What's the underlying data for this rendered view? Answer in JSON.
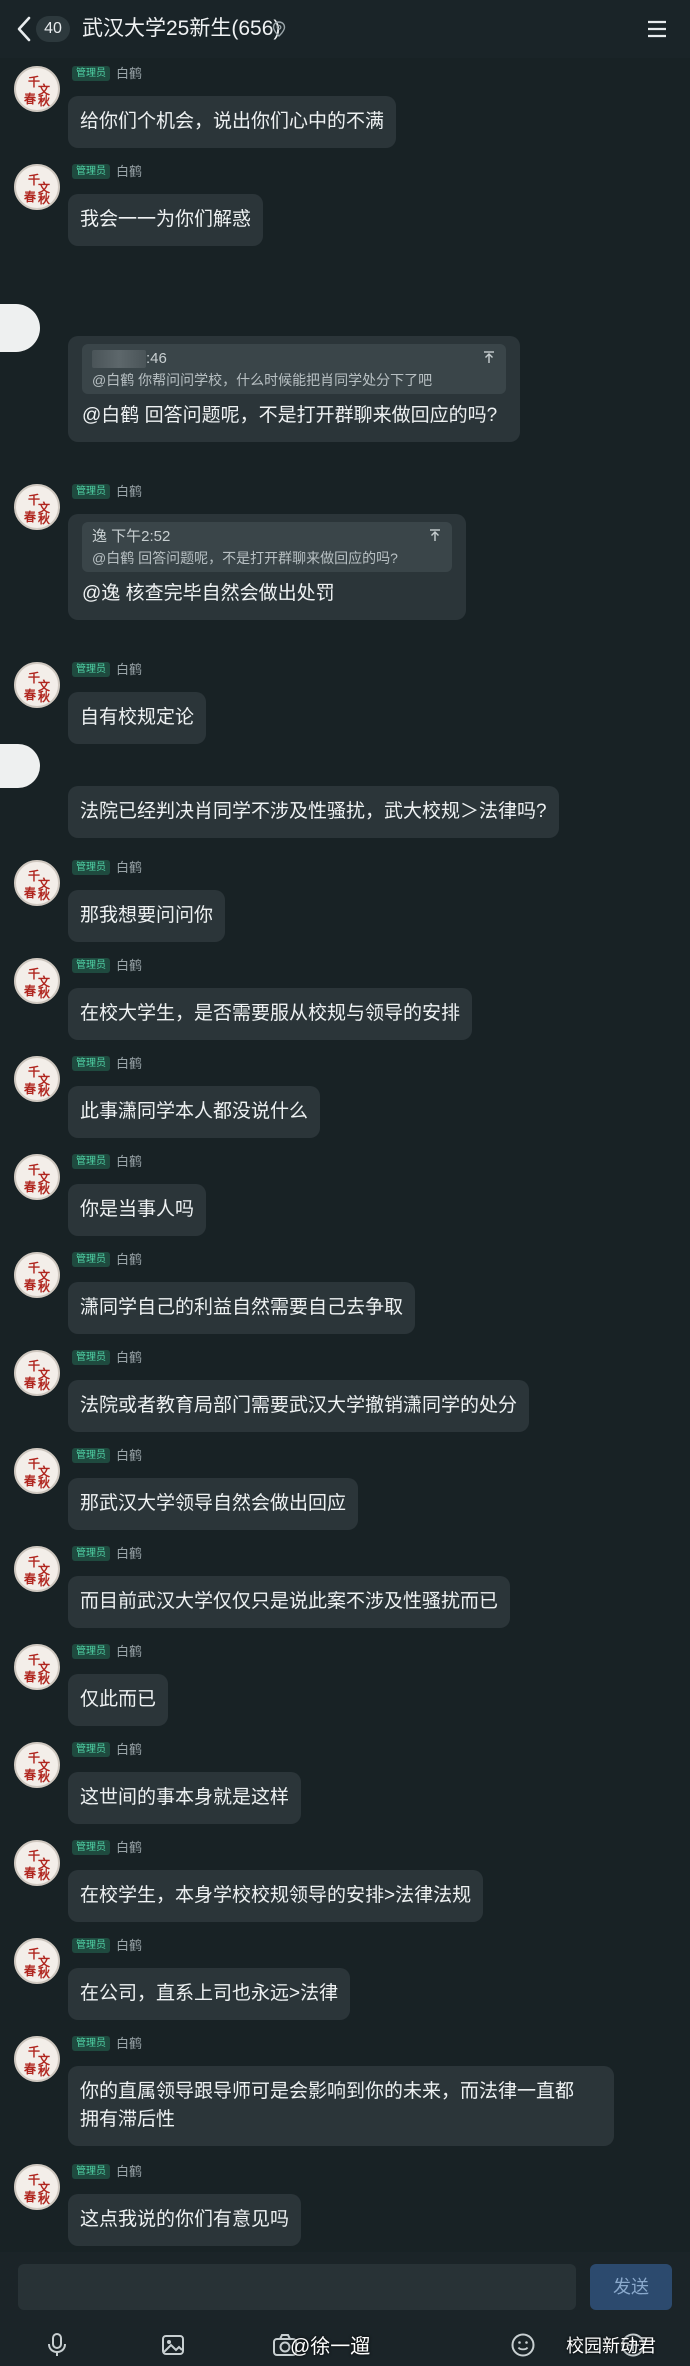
{
  "header": {
    "unread_count": "40",
    "title": "武汉大学25新生(656)"
  },
  "common": {
    "role_label": "管理员",
    "sender_name": "白鹤"
  },
  "messages": [
    {
      "text": "给你们个机会，说出你们心中的不满"
    },
    {
      "text": "我会一一为你们解惑"
    },
    {
      "quote_head": ":46",
      "quote_text": "@白鹤 你帮问问学校，什么时候能把肖同学处分下了吧",
      "text": "@白鹤 回答问题呢，不是打开群聊来做回应的吗?"
    },
    {
      "quote_head": "逸 下午2:52",
      "quote_text": "@白鹤 回答问题呢，不是打开群聊来做回应的吗?",
      "text": "@逸 核查完毕自然会做出处罚"
    },
    {
      "text": "自有校规定论"
    },
    {
      "text": "法院已经判决肖同学不涉及性骚扰，武大校规＞法律吗?"
    },
    {
      "text": "那我想要问问你"
    },
    {
      "text": "在校大学生，是否需要服从校规与领导的安排"
    },
    {
      "text": "此事潇同学本人都没说什么"
    },
    {
      "text": "你是当事人吗"
    },
    {
      "text": "潇同学自己的利益自然需要自己去争取"
    },
    {
      "text": "法院或者教育局部门需要武汉大学撤销潇同学的处分"
    },
    {
      "text": "那武汉大学领导自然会做出回应"
    },
    {
      "text": "而目前武汉大学仅仅只是说此案不涉及性骚扰而已"
    },
    {
      "text": "仅此而已"
    },
    {
      "text": "这世间的事本身就是这样"
    },
    {
      "text": "在校学生，本身学校校规领导的安排>法律法规"
    },
    {
      "text": "在公司，直系上司也永远>法律"
    },
    {
      "text_line1": "你的直属领导跟导师可是会影响到你的未来，而法律一直都",
      "text_line2": "拥有滞后性"
    },
    {
      "text": "这点我说的你们有意见吗"
    }
  ],
  "avatar_glyphs": [
    "千",
    "文",
    "春",
    "秋"
  ],
  "input": {
    "send_label": "发送"
  },
  "watermarks": {
    "weibo_user": "@徐一遛",
    "source": "校园新动君"
  },
  "colors": {
    "background": "#182225",
    "bubble": "#2b3539",
    "role_badge": "#4fd1a5",
    "send_button": "#2c4a6e"
  },
  "icons": [
    "back-arrow-icon",
    "location-pin-icon",
    "menu-icon",
    "microphone-icon",
    "image-icon",
    "camera-icon",
    "emoji-icon",
    "plus-icon"
  ]
}
